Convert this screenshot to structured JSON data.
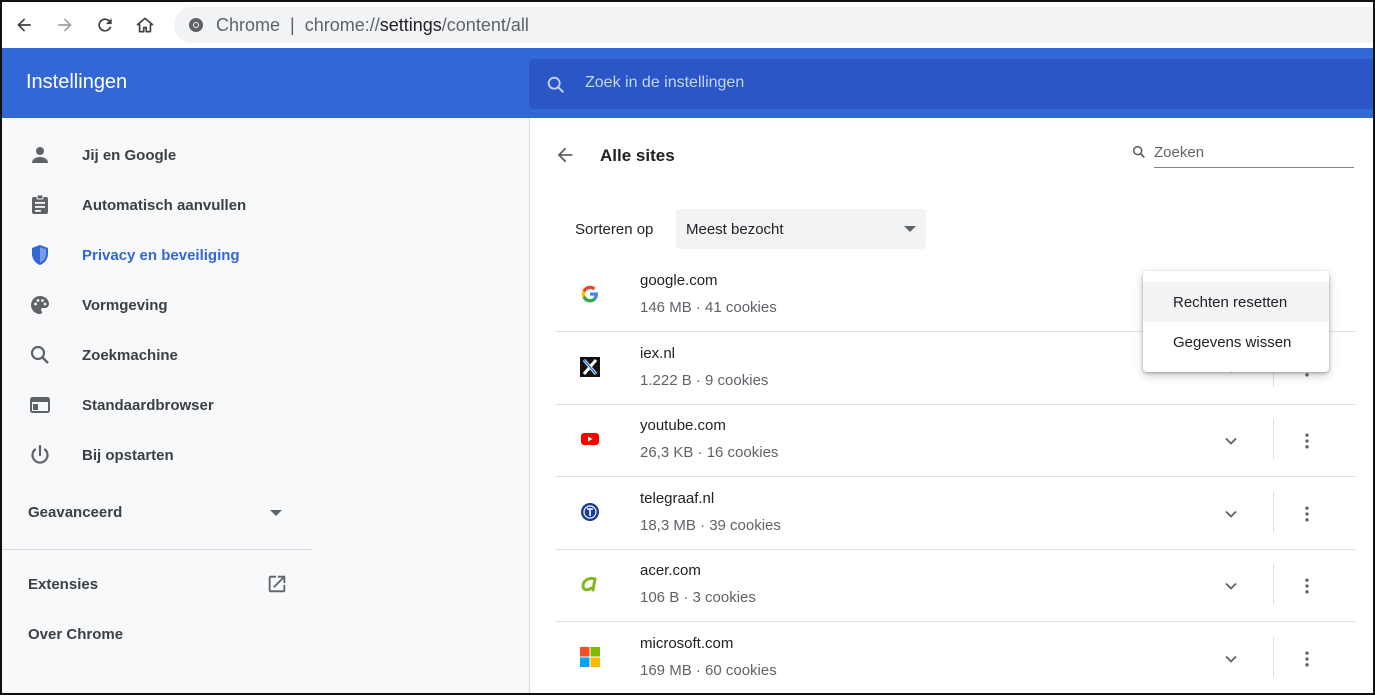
{
  "browser": {
    "scheme_label": "Chrome",
    "separator": "|",
    "url_prefix": "chrome://",
    "url_host": "settings",
    "url_path": "/content/all"
  },
  "header": {
    "title": "Instellingen",
    "search_placeholder": "Zoek in de instellingen"
  },
  "sidebar": {
    "items": [
      {
        "label": "Jij en Google",
        "icon": "person-icon"
      },
      {
        "label": "Automatisch aanvullen",
        "icon": "clipboard-icon"
      },
      {
        "label": "Privacy en beveiliging",
        "icon": "shield-icon",
        "active": true
      },
      {
        "label": "Vormgeving",
        "icon": "palette-icon"
      },
      {
        "label": "Zoekmachine",
        "icon": "search-icon"
      },
      {
        "label": "Standaardbrowser",
        "icon": "browser-window-icon"
      },
      {
        "label": "Bij opstarten",
        "icon": "power-icon"
      }
    ],
    "advanced": "Geavanceerd",
    "extensions": "Extensies",
    "about": "Over Chrome"
  },
  "main": {
    "title": "Alle sites",
    "search_placeholder": "Zoeken",
    "sort_label": "Sorteren op",
    "sort_value": "Meest bezocht",
    "sites": [
      {
        "name": "google.com",
        "meta": "146 MB · 41 cookies",
        "favicon": "google-favicon"
      },
      {
        "name": "iex.nl",
        "meta": "1.222 B · 9 cookies",
        "favicon": "iex-favicon"
      },
      {
        "name": "youtube.com",
        "meta": "26,3 KB · 16 cookies",
        "favicon": "youtube-favicon"
      },
      {
        "name": "telegraaf.nl",
        "meta": "18,3 MB · 39 cookies",
        "favicon": "telegraaf-favicon"
      },
      {
        "name": "acer.com",
        "meta": "106 B · 3 cookies",
        "favicon": "acer-favicon"
      },
      {
        "name": "microsoft.com",
        "meta": "169 MB · 60 cookies",
        "favicon": "microsoft-favicon"
      }
    ]
  },
  "context_menu": {
    "items": [
      "Rechten resetten",
      "Gegevens wissen"
    ]
  },
  "colors": {
    "header_blue": "#3367d6",
    "search_blue": "#2a56c6",
    "active_blue": "#3367d6"
  }
}
